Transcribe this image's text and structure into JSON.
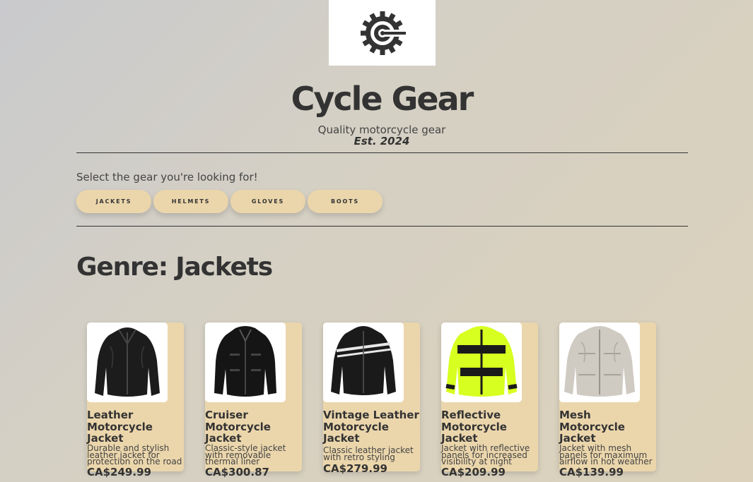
{
  "header": {
    "logo_icon": "gear-c-logo-icon",
    "title": "Cycle Gear",
    "tagline": "Quality motorcycle gear",
    "established": "Est. 2024"
  },
  "gear_selector": {
    "prompt": "Select the gear you're looking for!",
    "tabs": [
      {
        "label": "JACKETS"
      },
      {
        "label": "HELMETS"
      },
      {
        "label": "GLOVES"
      },
      {
        "label": "BOOTS"
      }
    ]
  },
  "genre": {
    "heading": "Genre: Jackets"
  },
  "products": [
    {
      "name": "Leather Motorcycle Jacket",
      "description": "Durable and stylish leather jacket for protection on the road",
      "price": "CA$249.99",
      "image_icon": "black-leather-jacket-icon"
    },
    {
      "name": "Cruiser Motorcycle Jacket",
      "description": "Classic-style jacket with removable thermal liner",
      "price": "CA$300.87",
      "image_icon": "black-cruiser-jacket-icon"
    },
    {
      "name": "Vintage Leather Motorcycle Jacket",
      "description": "Classic leather jacket with retro styling",
      "price": "CA$279.99",
      "image_icon": "striped-vintage-jacket-icon"
    },
    {
      "name": "Reflective Motorcycle Jacket",
      "description": "Jacket with reflective panels for increased visibility at night",
      "price": "CA$209.99",
      "image_icon": "hi-vis-jacket-icon"
    },
    {
      "name": "Mesh Motorcycle Jacket",
      "description": "Jacket with mesh panels for maximum airflow in hot weather",
      "price": "CA$139.99",
      "image_icon": "grey-mesh-jacket-icon"
    }
  ],
  "colors": {
    "accent": "#ebd6ac",
    "text": "#333333"
  }
}
